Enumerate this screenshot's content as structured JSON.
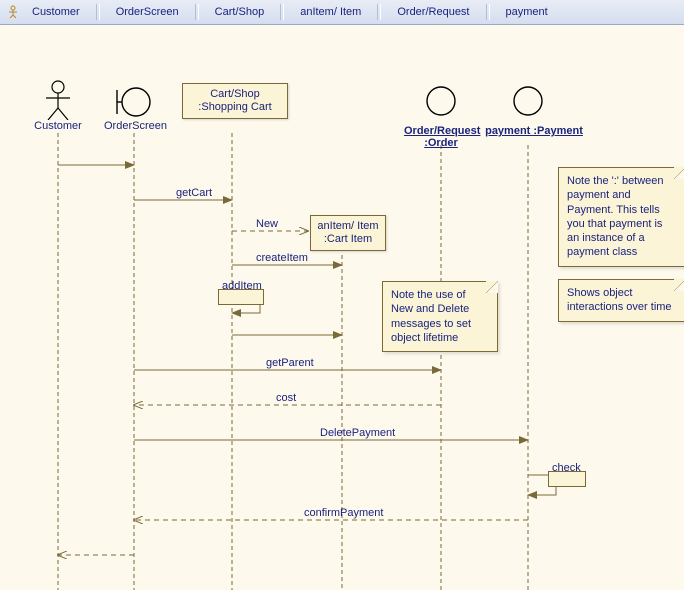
{
  "toolbar": {
    "items": [
      "Customer",
      "OrderScreen",
      "Cart/Shop",
      "anItem/ Item",
      "Order/Request",
      "payment"
    ]
  },
  "actors": {
    "customer": "Customer",
    "orderscreen": "OrderScreen",
    "cartshop": "Cart/Shop :Shopping Cart",
    "anitem": "anItem/ Item :Cart Item",
    "orderrequest": "Order/Request :Order",
    "payment": "payment :Payment"
  },
  "messages": {
    "getCart": "getCart",
    "new": "New",
    "createItem": "createItem",
    "addItem": "addItem",
    "getParent": "getParent",
    "cost": "cost",
    "deletePayment": "DeletePayment",
    "check": "check",
    "confirmPayment": "confirmPayment"
  },
  "notes": {
    "lifetime": "Note the use of New and Delete messages to set object lifetime",
    "instance": "Note the ':' between payment and Payment. This tells you that payment is an instance of a payment class",
    "interactions": "Shows object interactions over time"
  },
  "chart_data": {
    "type": "sequence-diagram",
    "participants": [
      {
        "id": "customer",
        "name": "Customer",
        "kind": "actor"
      },
      {
        "id": "orderscreen",
        "name": "OrderScreen",
        "kind": "boundary"
      },
      {
        "id": "cartshop",
        "name": "Cart/Shop :Shopping Cart",
        "kind": "object"
      },
      {
        "id": "anitem",
        "name": "anItem/ Item :Cart Item",
        "kind": "object"
      },
      {
        "id": "orderrequest",
        "name": "Order/Request :Order",
        "kind": "object"
      },
      {
        "id": "payment",
        "name": "payment :Payment",
        "kind": "object"
      }
    ],
    "messages": [
      {
        "from": "customer",
        "to": "orderscreen",
        "label": "",
        "type": "call"
      },
      {
        "from": "orderscreen",
        "to": "cartshop",
        "label": "getCart",
        "type": "call"
      },
      {
        "from": "cartshop",
        "to": "anitem",
        "label": "New",
        "type": "create"
      },
      {
        "from": "cartshop",
        "to": "anitem",
        "label": "createItem",
        "type": "call"
      },
      {
        "from": "cartshop",
        "to": "cartshop",
        "label": "addItem",
        "type": "self"
      },
      {
        "from": "cartshop",
        "to": "anitem",
        "label": "",
        "type": "call"
      },
      {
        "from": "orderscreen",
        "to": "orderrequest",
        "label": "getParent",
        "type": "call"
      },
      {
        "from": "orderscreen",
        "to": "orderrequest",
        "label": "cost",
        "type": "return"
      },
      {
        "from": "orderscreen",
        "to": "payment",
        "label": "DeletePayment",
        "type": "call"
      },
      {
        "from": "payment",
        "to": "payment",
        "label": "check",
        "type": "self"
      },
      {
        "from": "orderscreen",
        "to": "payment",
        "label": "confirmPayment",
        "type": "return"
      },
      {
        "from": "customer",
        "to": "orderscreen",
        "label": "",
        "type": "return"
      }
    ],
    "notes": [
      {
        "text": "Note the use of New and Delete messages to set object lifetime",
        "attached": "anitem"
      },
      {
        "text": "Note the ':' between payment and Payment. This tells you that payment is an instance of a payment class",
        "attached": "payment"
      },
      {
        "text": "Shows object interactions over time",
        "attached": "payment"
      }
    ]
  }
}
